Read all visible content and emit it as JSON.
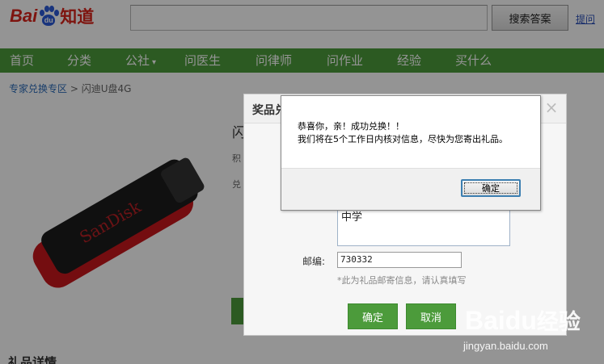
{
  "header": {
    "logo_bai": "Bai",
    "logo_du": "du",
    "logo_zhidao": "知道",
    "search_value": "",
    "search_button": "搜索答案",
    "ask_link": "提问"
  },
  "nav": {
    "items": [
      {
        "label": "首页"
      },
      {
        "label": "分类"
      },
      {
        "label": "公社",
        "chevron": "▾"
      },
      {
        "label": "问医生"
      },
      {
        "label": "问律师"
      },
      {
        "label": "问作业"
      },
      {
        "label": "经验"
      },
      {
        "label": "买什么"
      }
    ]
  },
  "breadcrumb": {
    "link": "专家兑换专区",
    "separator": " > ",
    "current": "闪迪U盘4G"
  },
  "product": {
    "title_fragment": "闪",
    "meta1_fragment": "积",
    "meta2_fragment": "兑",
    "brand_text": "SanDisk",
    "detail_title": "礼品详情"
  },
  "exchange_dialog": {
    "title": "奖品兑",
    "close_icon": "close-icon",
    "address_value": "中学",
    "zip_label": "邮编:",
    "zip_value": "730332",
    "zip_note": "*此为礼品邮寄信息，请认真填写",
    "confirm_label": "确定",
    "cancel_label": "取消"
  },
  "alert": {
    "line1": "恭喜你，亲！成功兑换！！",
    "line2": "我们将在5个工作日内核对信息，尽快为您寄出礼品。",
    "ok_label": "确定"
  },
  "watermark": {
    "logo_bai": "Bai",
    "logo_du": "du",
    "logo_jingyan": "经验",
    "url": "jingyan.baidu.com"
  },
  "colors": {
    "nav_green": "#4c9b3b",
    "baidu_red": "#d9241a",
    "baidu_blue": "#2b5bd7"
  }
}
